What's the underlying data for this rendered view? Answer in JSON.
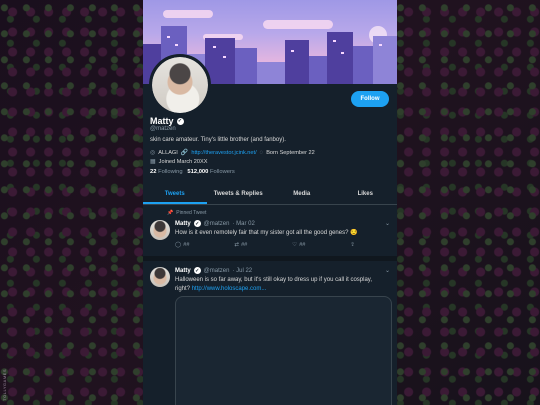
{
  "watermark": "TOLLYGAMES",
  "profile": {
    "name": "Matty",
    "handle": "@matzen",
    "bio": "skin care amateur. Tiny's little brother (and fanboy).",
    "location": "ALLAGI",
    "url": "http://theravestor.jcink.net/",
    "birthday": "Born September 22",
    "joined": "Joined March 20XX",
    "following_count": "22",
    "following_label": "Following",
    "followers_count": "512,000",
    "followers_label": "Followers",
    "follow_button": "Follow"
  },
  "tabs": [
    {
      "label": "Tweets",
      "active": true
    },
    {
      "label": "Tweets & Replies",
      "active": false
    },
    {
      "label": "Media",
      "active": false
    },
    {
      "label": "Likes",
      "active": false
    }
  ],
  "tweets": [
    {
      "pinned_label": "Pinned Tweet",
      "name": "Matty",
      "handle": "@matzen",
      "date": "· Mar 02",
      "text": "How is it even remotely fair that my sister got all the good genes? 😒",
      "replies": "##",
      "retweets": "##",
      "likes": "##"
    },
    {
      "name": "Matty",
      "handle": "@matzen",
      "date": "· Jul 22",
      "text": "Halloween is so far away, but it's still okay to dress up if you call it cosplay, right?",
      "link": "http://www.holoscape.com..."
    }
  ],
  "colors": {
    "accent": "#1da1f2",
    "panel": "#15202b",
    "muted": "#8899a6"
  },
  "icons": [
    "verified-icon",
    "location-icon",
    "link-icon",
    "birthday-icon",
    "calendar-icon",
    "pin-icon",
    "reply-icon",
    "retweet-icon",
    "like-icon",
    "share-icon",
    "chevron-down-icon"
  ]
}
